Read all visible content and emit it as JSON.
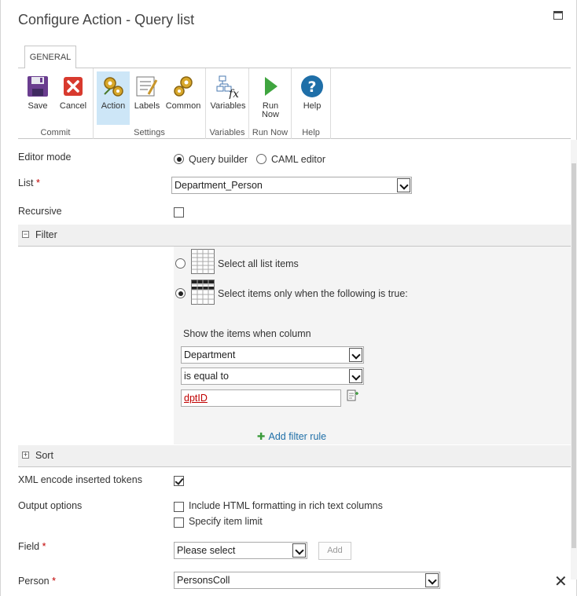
{
  "dialog": {
    "title": "Configure Action - Query list"
  },
  "ribbon": {
    "tab": "GENERAL",
    "groups": [
      {
        "label": "Commit",
        "buttons": [
          "Save",
          "Cancel"
        ]
      },
      {
        "label": "Settings",
        "buttons": [
          "Action",
          "Labels",
          "Common"
        ]
      },
      {
        "label": "Variables",
        "buttons": [
          "Variables"
        ]
      },
      {
        "label": "Run Now",
        "buttons": [
          "Run Now"
        ]
      },
      {
        "label": "Help",
        "buttons": [
          "Help"
        ]
      }
    ],
    "run_now_line1": "Run",
    "run_now_line2": "Now"
  },
  "form": {
    "editor_mode": {
      "label": "Editor mode",
      "options": [
        "Query builder",
        "CAML editor"
      ],
      "selected": "Query builder"
    },
    "list": {
      "label": "List",
      "value": "Department_Person"
    },
    "recursive": {
      "label": "Recursive",
      "checked": false
    },
    "filter": {
      "title": "Filter",
      "option_all": "Select all list items",
      "option_conditional": "Select items only when the following is true:",
      "show_items_label": "Show the items when column",
      "column": "Department",
      "operator": "is equal to",
      "value": "dptID",
      "add_rule": "Add filter rule"
    },
    "sort": {
      "title": "Sort"
    },
    "xml_encode": {
      "label": "XML encode inserted tokens",
      "checked": true
    },
    "output_options": {
      "label": "Output options",
      "include_html": "Include HTML formatting in rich text columns",
      "item_limit": "Specify item limit"
    },
    "field": {
      "label": "Field",
      "value": "Please select",
      "add_button": "Add"
    },
    "person": {
      "label": "Person",
      "value": "PersonsColl"
    },
    "required_mark": "*"
  },
  "colors": {
    "accent": "#1f6fa8",
    "active_button": "#cde6f7",
    "token": "#c00000"
  }
}
